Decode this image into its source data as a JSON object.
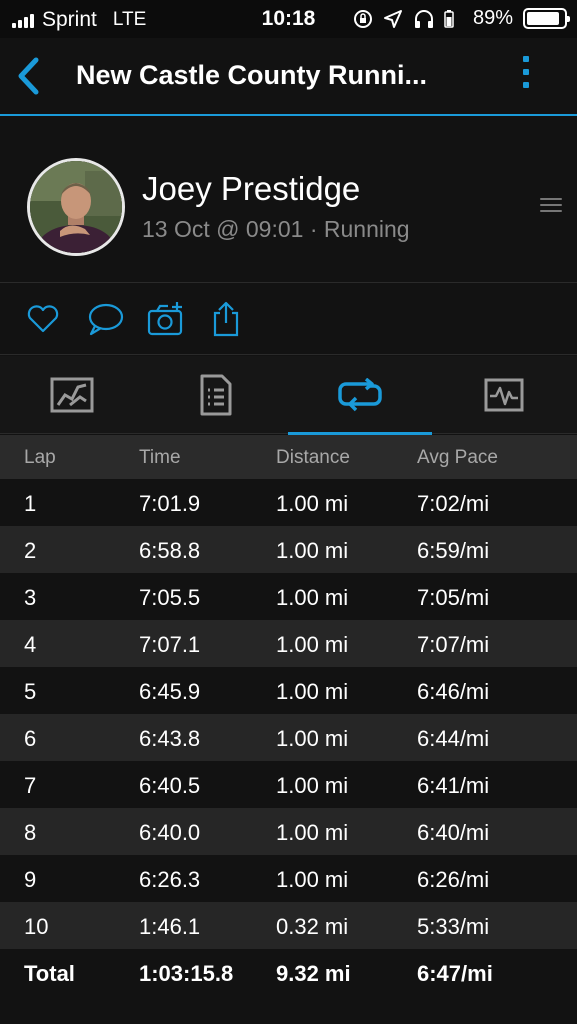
{
  "status_bar": {
    "carrier": "Sprint",
    "network": "LTE",
    "time": "10:18",
    "battery": "89%",
    "battery_level": 0.89
  },
  "nav": {
    "title": "New Castle County Runni...",
    "accent_color": "#1a9ad9"
  },
  "header": {
    "name": "Joey Prestidge",
    "meta": "13 Oct @ 09:01 · Running"
  },
  "actions": [
    "heart-icon",
    "comment-icon",
    "add-photo-icon",
    "share-icon"
  ],
  "tabs": [
    {
      "icon": "map-icon",
      "active": false
    },
    {
      "icon": "details-icon",
      "active": false
    },
    {
      "icon": "laps-icon",
      "active": true
    },
    {
      "icon": "charts-icon",
      "active": false
    }
  ],
  "table": {
    "headers": [
      "Lap",
      "Time",
      "Distance",
      "Avg Pace"
    ],
    "rows": [
      [
        "1",
        "7:01.9",
        "1.00 mi",
        "7:02/mi"
      ],
      [
        "2",
        "6:58.8",
        "1.00 mi",
        "6:59/mi"
      ],
      [
        "3",
        "7:05.5",
        "1.00 mi",
        "7:05/mi"
      ],
      [
        "4",
        "7:07.1",
        "1.00 mi",
        "7:07/mi"
      ],
      [
        "5",
        "6:45.9",
        "1.00 mi",
        "6:46/mi"
      ],
      [
        "6",
        "6:43.8",
        "1.00 mi",
        "6:44/mi"
      ],
      [
        "7",
        "6:40.5",
        "1.00 mi",
        "6:41/mi"
      ],
      [
        "8",
        "6:40.0",
        "1.00 mi",
        "6:40/mi"
      ],
      [
        "9",
        "6:26.3",
        "1.00 mi",
        "6:26/mi"
      ],
      [
        "10",
        "1:46.1",
        "0.32 mi",
        "5:33/mi"
      ]
    ],
    "total": [
      "Total",
      "1:03:15.8",
      "9.32 mi",
      "6:47/mi"
    ]
  }
}
